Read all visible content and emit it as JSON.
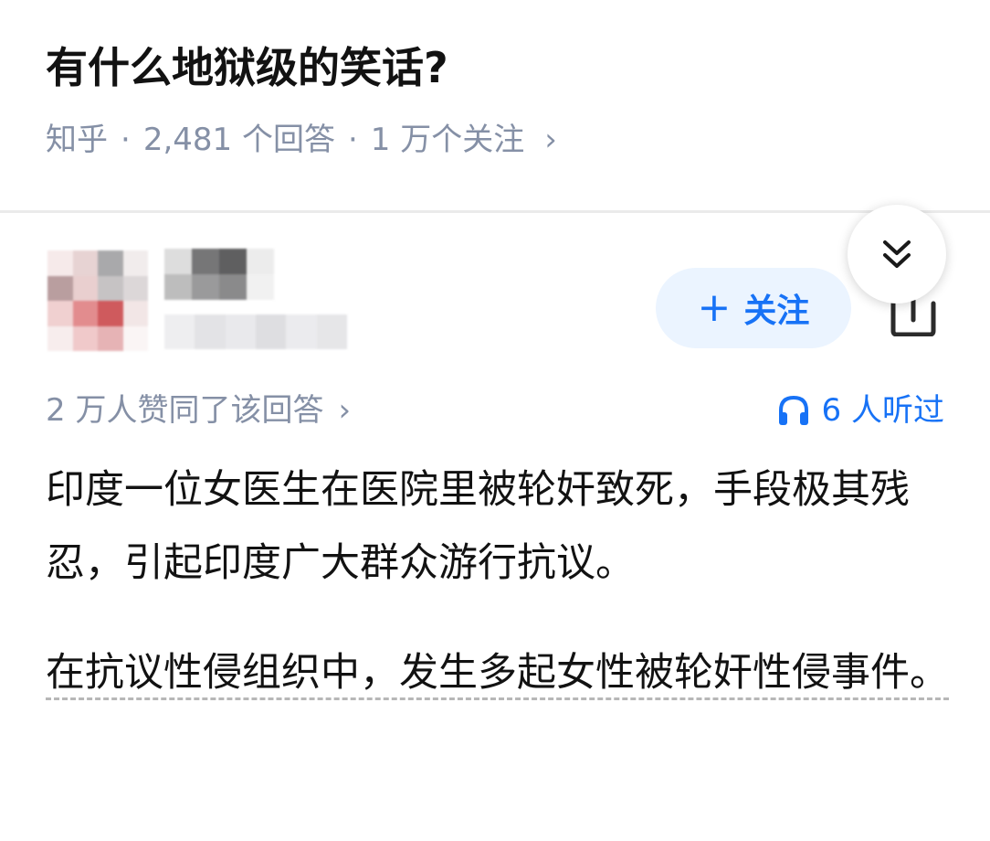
{
  "question": {
    "title": "有什么地狱级的笑话?",
    "source": "知乎",
    "separator": "·",
    "answer_count": "2,481 个回答",
    "follower_count": "1 万个关注",
    "meta_chevron": "›"
  },
  "author": {
    "follow_plus": "+",
    "follow_label": "关注"
  },
  "stats": {
    "upvotes": "2 万人赞同了该回答",
    "upvotes_chevron": "›",
    "listened": "6 人听过"
  },
  "answer": {
    "paragraph1": "印度一位女医生在医院里被轮奸致死，手段极其残忍，引起印度广大群众游行抗议。",
    "paragraph2": "在抗议性侵组织中，发生多起女性被轮奸性侵事件。"
  },
  "colors": {
    "accent": "#1772f6",
    "meta_gray": "#8590a6",
    "follow_bg": "#ebf4ff"
  },
  "icons": {
    "collapse": "double-chevron-down-icon",
    "share": "share-icon",
    "headphones": "headphones-icon"
  }
}
